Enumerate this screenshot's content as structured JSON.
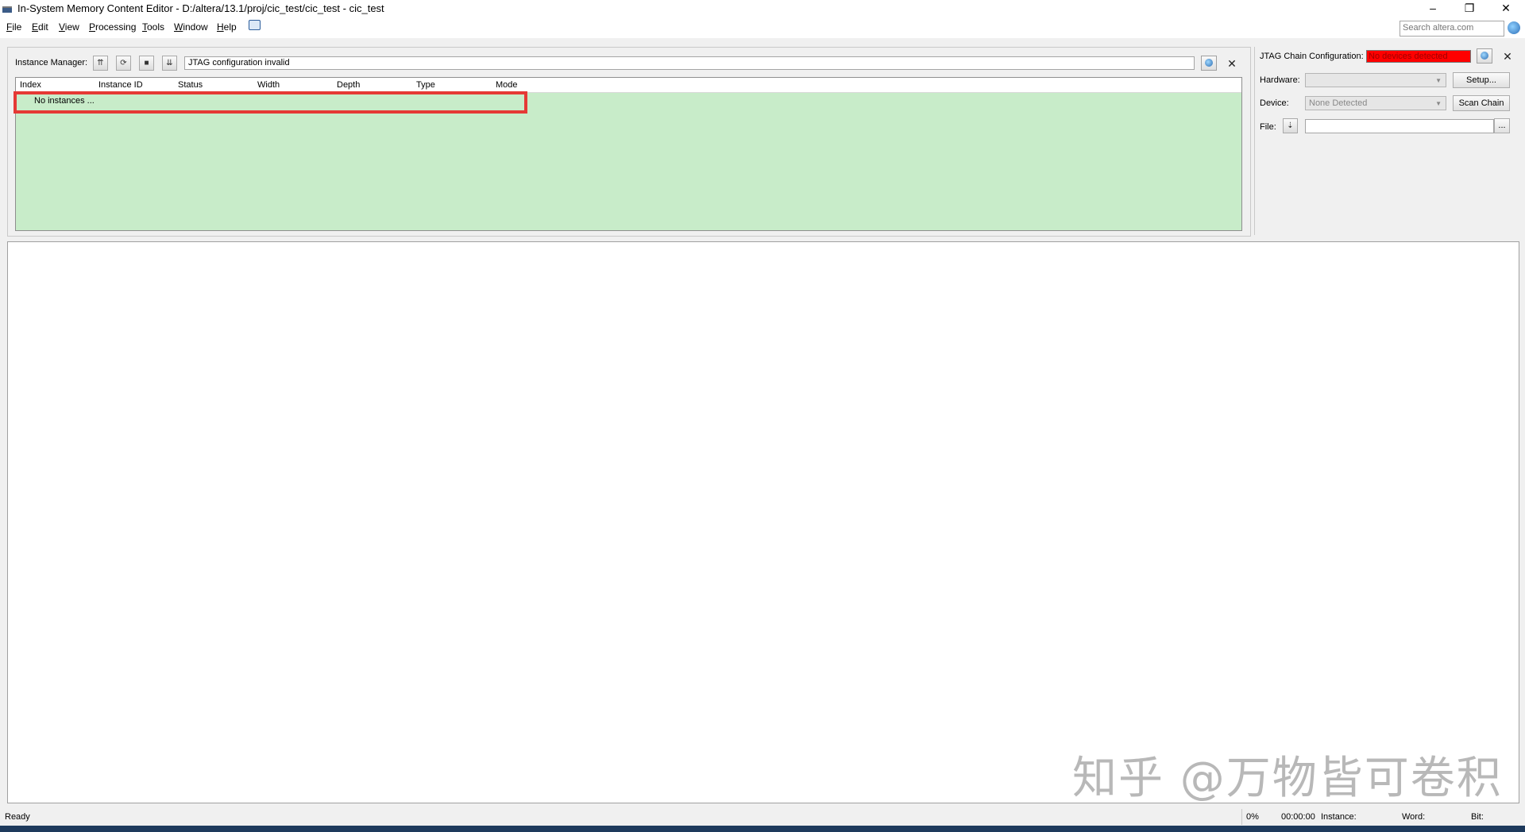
{
  "window": {
    "title": "In-System Memory Content Editor - D:/altera/13.1/proj/cic_test/cic_test - cic_test",
    "minimize": "–",
    "restore": "❐",
    "close": "✕"
  },
  "menu": [
    "File",
    "Edit",
    "View",
    "Processing",
    "Tools",
    "Window",
    "Help"
  ],
  "search": {
    "placeholder": "Search altera.com"
  },
  "instance_manager": {
    "label": "Instance Manager:",
    "status": "JTAG configuration invalid",
    "columns": [
      "Index",
      "Instance ID",
      "Status",
      "Width",
      "Depth",
      "Type",
      "Mode"
    ],
    "empty_text": "No instances ...",
    "close": "✕"
  },
  "jtag": {
    "label": "JTAG Chain Configuration:",
    "status": "No devices detected",
    "hardware_label": "Hardware:",
    "hardware_value": "",
    "setup_button": "Setup...",
    "device_label": "Device:",
    "device_value": "None Detected",
    "scan_button": "Scan Chain",
    "file_label": "File:",
    "file_value": "",
    "browse_button": "...",
    "close": "✕"
  },
  "watermark": "知乎 @万物皆可卷积",
  "statusbar": {
    "ready": "Ready",
    "progress": "0%",
    "time": "00:00:00",
    "instance": "Instance:",
    "word": "Word:",
    "bit": "Bit:"
  },
  "colors": {
    "table_bg": "#c8ecc9",
    "highlight": "#e53935",
    "jtag_status_bg": "#ff0000"
  }
}
